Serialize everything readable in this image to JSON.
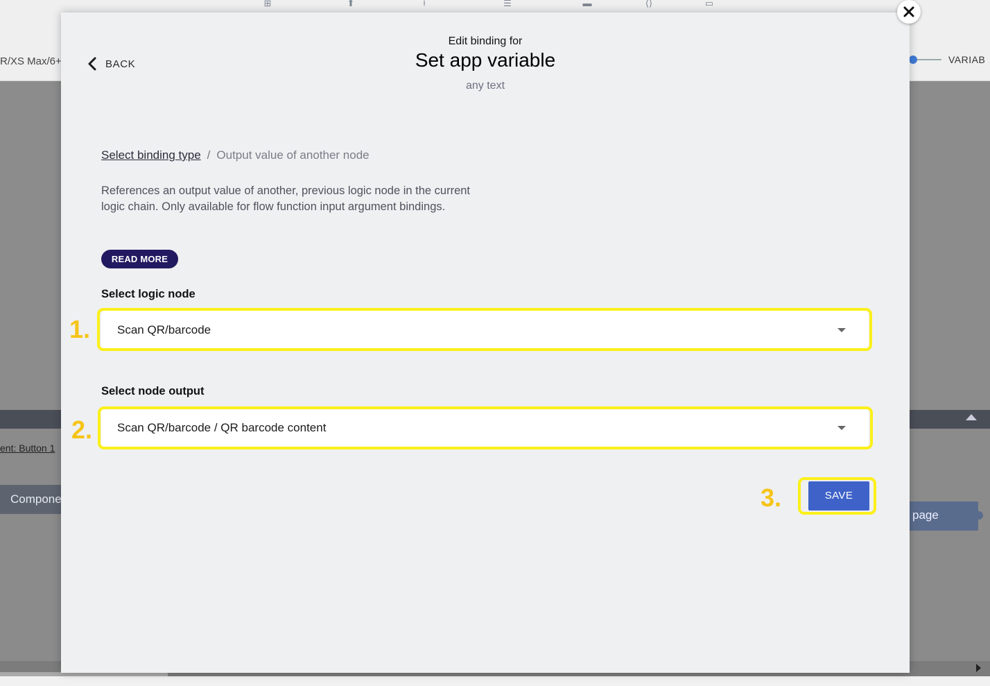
{
  "background": {
    "device_label": "R/XS Max/6+",
    "variables_label": "VARIAB",
    "breadcrumb": "ent: Button 1",
    "components_label": "Compone",
    "page_label": "page"
  },
  "modal": {
    "back_label": "BACK",
    "header_subtitle": "Edit binding for",
    "header_title": "Set app variable",
    "header_description": "any text",
    "breadcrumb_link": "Select binding type",
    "breadcrumb_separator": "/",
    "breadcrumb_current": "Output value of another node",
    "description": "References an output value of another, previous logic node in the current logic chain. Only available for flow function input argument bindings.",
    "read_more_label": "READ MORE",
    "logic_node_label": "Select logic node",
    "logic_node_value": "Scan QR/barcode",
    "node_output_label": "Select node output",
    "node_output_value": "Scan QR/barcode / QR barcode content",
    "save_label": "SAVE"
  },
  "annotations": {
    "step1": "1.",
    "step2": "2.",
    "step3": "3.",
    "highlight_color": "#fbf01a",
    "number_color": "#f6c418"
  },
  "colors": {
    "accent": "#3e62c8",
    "read_more_bg": "#211a60",
    "modal_bg": "#eff0f2"
  }
}
